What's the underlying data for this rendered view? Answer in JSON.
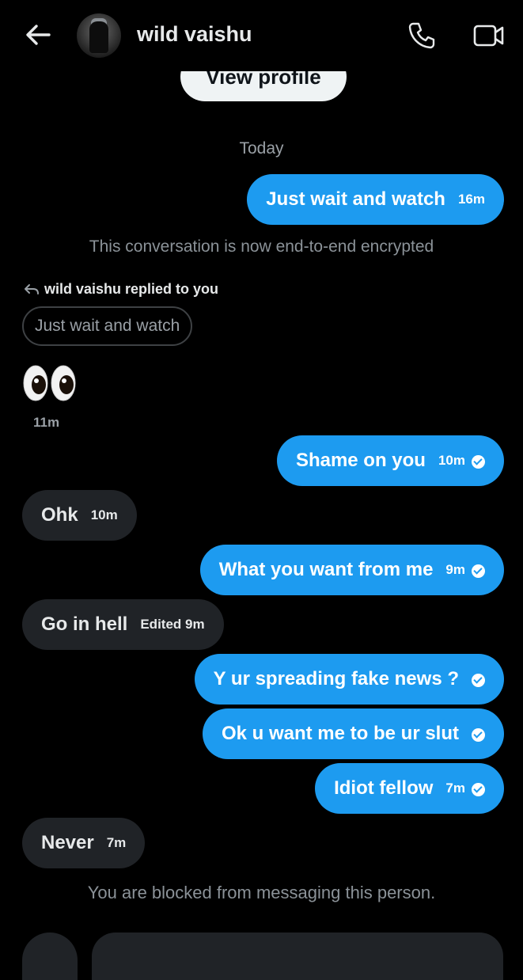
{
  "header": {
    "title": "wild vaishu",
    "back_icon": "arrow-left-icon",
    "call_icon": "phone-icon",
    "video_icon": "video-camera-icon"
  },
  "profile": {
    "view_label": "View profile"
  },
  "thread": {
    "day_label": "Today",
    "encrypted_notice": "This conversation is now end-to-end encrypted",
    "reply_context": {
      "label": "wild vaishu replied to you",
      "quoted_text": "Just wait and watch",
      "emoji": "eyes",
      "time": "11m"
    },
    "messages": [
      {
        "direction": "outgoing",
        "text": "Just wait and watch",
        "meta": "16m",
        "read": false
      },
      {
        "direction": "outgoing",
        "text": "Shame on you",
        "meta": "10m",
        "read": true
      },
      {
        "direction": "incoming",
        "text": "Ohk",
        "meta": "10m"
      },
      {
        "direction": "outgoing",
        "text": "What you want from me",
        "meta": "9m",
        "read": true
      },
      {
        "direction": "incoming",
        "text": "Go in hell",
        "meta": "Edited 9m"
      },
      {
        "direction": "outgoing",
        "text": "Y ur spreading fake news  ?",
        "meta": "",
        "read": true
      },
      {
        "direction": "outgoing",
        "text": "Ok u want me to be ur slut",
        "meta": "",
        "read": true
      },
      {
        "direction": "outgoing",
        "text": "Idiot fellow",
        "meta": "7m",
        "read": true
      },
      {
        "direction": "incoming",
        "text": "Never",
        "meta": "7m"
      }
    ],
    "blocked_notice": "You are blocked from messaging this person."
  },
  "colors": {
    "background": "#000000",
    "outgoing_bubble": "#1d9bf0",
    "incoming_bubble": "#202327",
    "muted_text": "#8b9298"
  }
}
